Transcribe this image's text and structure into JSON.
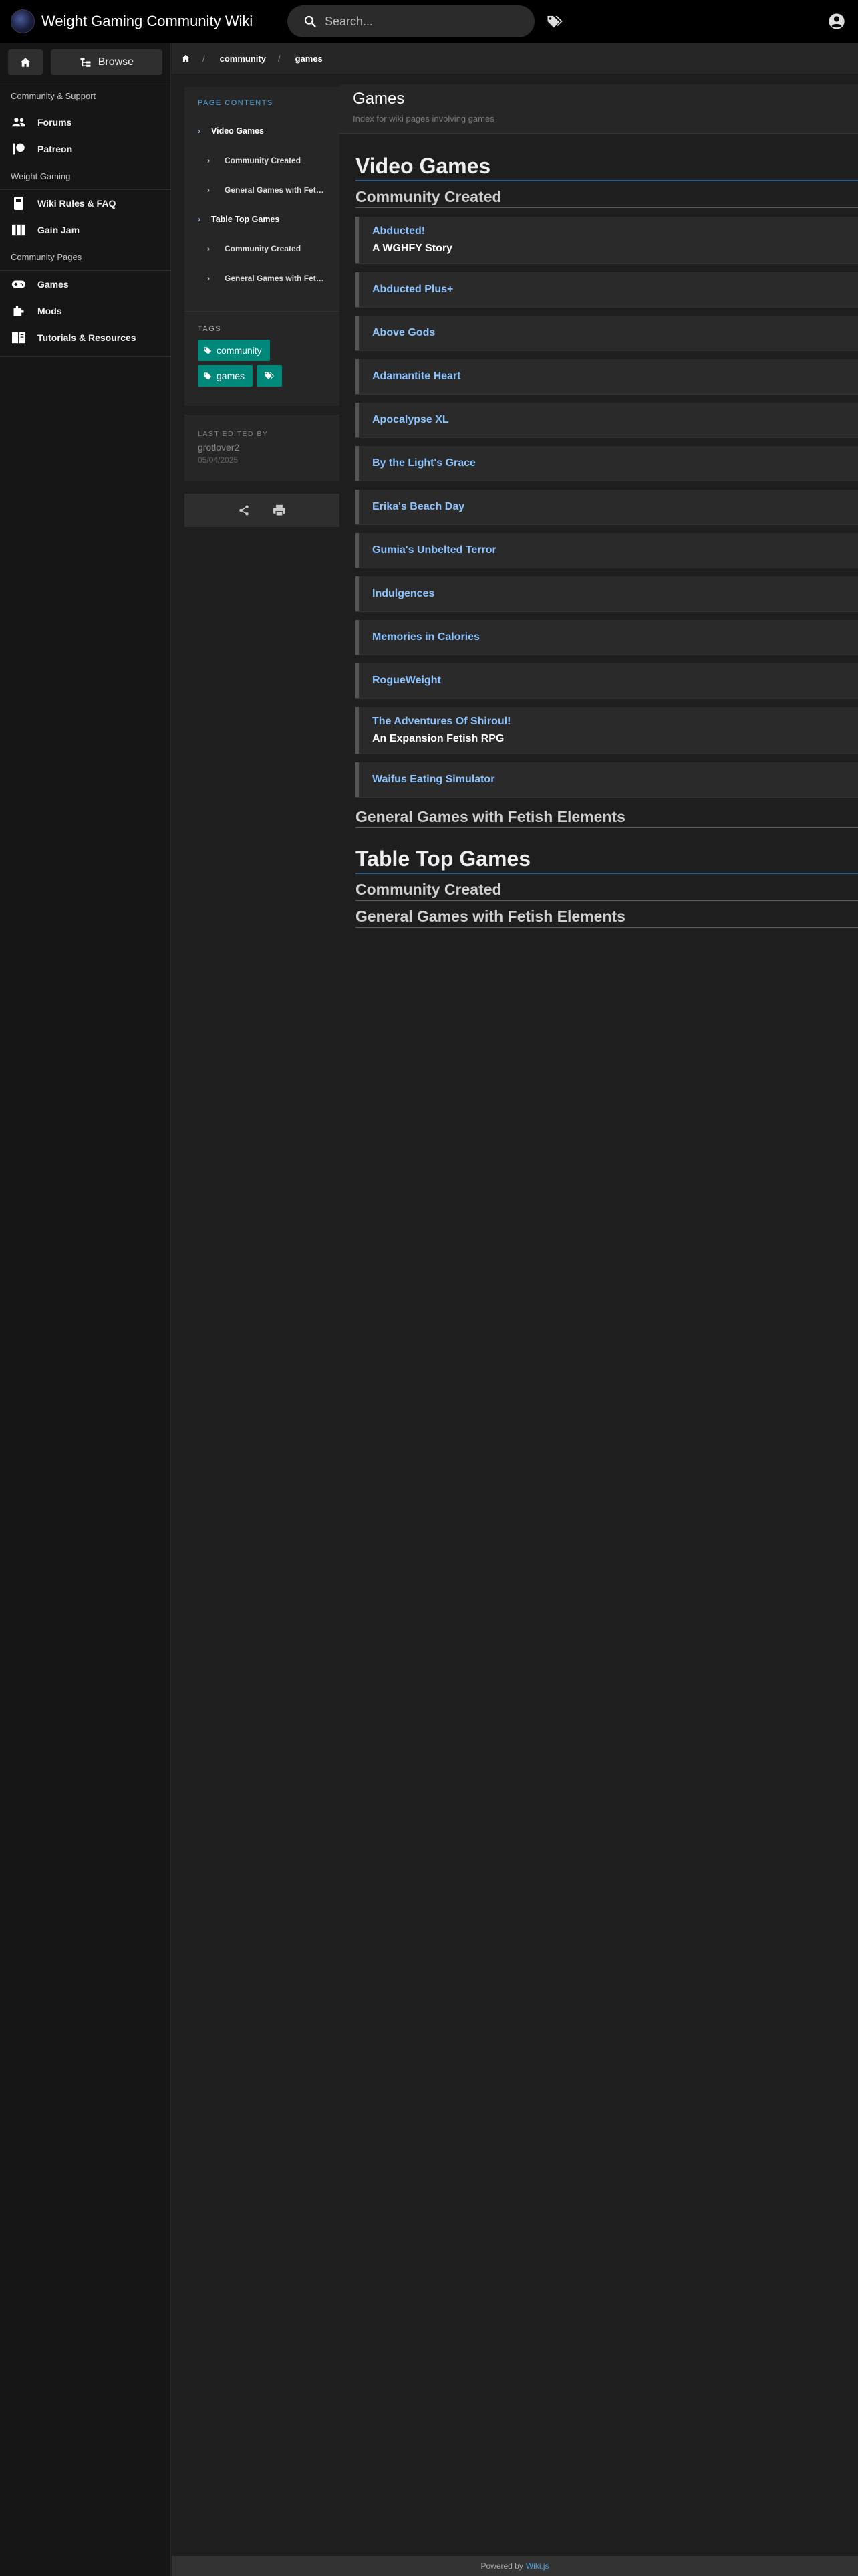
{
  "header": {
    "site_title": "Weight Gaming Community Wiki",
    "search_placeholder": "Search..."
  },
  "nav": {
    "browse_label": "Browse",
    "sections": [
      {
        "header": "Community & Support",
        "items": [
          {
            "label": "Forums",
            "icon": "people-icon"
          },
          {
            "label": "Patreon",
            "icon": "patreon-icon"
          }
        ]
      },
      {
        "header": "Weight Gaming",
        "items": [
          {
            "label": "Wiki Rules & FAQ",
            "icon": "book-icon"
          },
          {
            "label": "Gain Jam",
            "icon": "map-icon"
          }
        ]
      },
      {
        "header": "Community Pages",
        "items": [
          {
            "label": "Games",
            "icon": "gamepad-icon"
          },
          {
            "label": "Mods",
            "icon": "plugin-icon"
          },
          {
            "label": "Tutorials & Resources",
            "icon": "book-open-icon"
          }
        ]
      }
    ]
  },
  "breadcrumbs": [
    "community",
    "games"
  ],
  "page": {
    "title": "Games",
    "description": "Index for wiki pages involving games"
  },
  "toc": {
    "label": "Page Contents",
    "items": [
      {
        "label": "Video Games",
        "level": 1
      },
      {
        "label": "Community Created",
        "level": 2
      },
      {
        "label": "General Games with Fetish Elements",
        "level": 2
      },
      {
        "label": "Table Top Games",
        "level": 1
      },
      {
        "label": "Community Created",
        "level": 2
      },
      {
        "label": "General Games with Fetish Elements",
        "level": 2
      }
    ]
  },
  "tags": {
    "label": "Tags",
    "items": [
      "community",
      "games"
    ]
  },
  "last_edited": {
    "label": "Last edited by",
    "editor": "grotlover2",
    "date": "05/04/2025"
  },
  "content": {
    "video_games": {
      "heading": "Video Games",
      "community_created": {
        "heading": "Community Created",
        "games": [
          {
            "title": "Abducted!",
            "subtitle": "A WGHFY Story"
          },
          {
            "title": "Abducted Plus+"
          },
          {
            "title": "Above Gods"
          },
          {
            "title": "Adamantite Heart"
          },
          {
            "title": "Apocalypse XL"
          },
          {
            "title": "By the Light's Grace"
          },
          {
            "title": "Erika's Beach Day"
          },
          {
            "title": "Gumia's Unbelted Terror"
          },
          {
            "title": "Indulgences"
          },
          {
            "title": "Memories in Calories"
          },
          {
            "title": "RogueWeight"
          },
          {
            "title": "The Adventures Of Shiroul!",
            "subtitle": "An Expansion Fetish RPG"
          },
          {
            "title": "Waifus Eating Simulator"
          }
        ]
      },
      "general_heading": "General Games with Fetish Elements"
    },
    "table_top": {
      "heading": "Table Top Games",
      "community_created_heading": "Community Created",
      "general_heading": "General Games with Fetish Elements"
    }
  },
  "footer": {
    "powered_by": "Powered by",
    "engine": "Wiki.js"
  }
}
